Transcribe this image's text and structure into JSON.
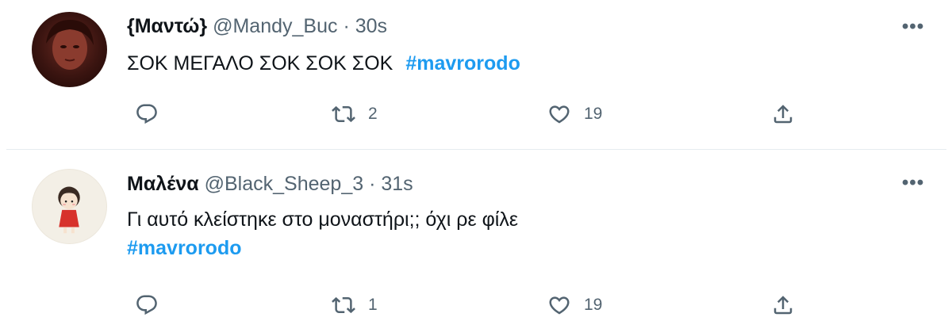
{
  "colors": {
    "accent": "#1d9bf0",
    "muted": "#536471",
    "text": "#0f1419",
    "divider": "#e6ecf0"
  },
  "tweets": [
    {
      "name": "{Μαντώ}",
      "handle": "@Mandy_Buc",
      "separator": "·",
      "time": "30s",
      "text": "ΣΟΚ ΜΕΓΑΛΟ ΣΟΚ ΣΟΚ ΣΟΚ",
      "hashtag": "#mavrorodo",
      "more": "•••",
      "retweets": "2",
      "likes": "19",
      "icons": [
        "reply-icon",
        "retweet-icon",
        "like-icon",
        "share-icon",
        "more-icon"
      ]
    },
    {
      "name": "Μαλένα",
      "handle": "@Black_Sheep_3",
      "separator": "·",
      "time": "31s",
      "text": "Γι αυτό κλείστηκε στο μοναστήρι;; όχι ρε φίλε",
      "hashtag": "#mavrorodo",
      "more": "•••",
      "retweets": "1",
      "likes": "19",
      "icons": [
        "reply-icon",
        "retweet-icon",
        "like-icon",
        "share-icon",
        "more-icon"
      ]
    }
  ]
}
